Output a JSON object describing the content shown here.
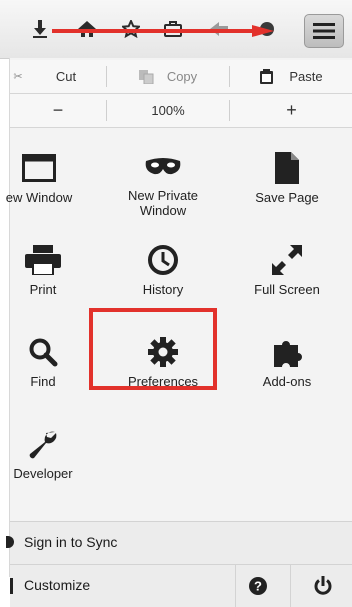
{
  "toolbar": {
    "icons": [
      "download-icon",
      "home-icon",
      "bookmark-star-icon",
      "bag-icon",
      "back-arrow-icon",
      "forward-icon",
      "hamburger-menu-icon"
    ],
    "annotation_arrow_color": "#e2312b"
  },
  "edit": {
    "cut": "Cut",
    "copy": "Copy",
    "paste": "Paste"
  },
  "zoom": {
    "minus": "−",
    "level": "100%",
    "plus": "+"
  },
  "items": [
    {
      "label": "ew Window",
      "icon": "window-icon"
    },
    {
      "label": "New Private Window",
      "icon": "mask-icon"
    },
    {
      "label": "Save Page",
      "icon": "page-icon"
    },
    {
      "label": "Print",
      "icon": "printer-icon"
    },
    {
      "label": "History",
      "icon": "clock-icon"
    },
    {
      "label": "Full Screen",
      "icon": "fullscreen-icon"
    },
    {
      "label": "Find",
      "icon": "magnifier-icon"
    },
    {
      "label": "Preferences",
      "icon": "gear-icon"
    },
    {
      "label": "Add-ons",
      "icon": "puzzle-icon"
    },
    {
      "label": "Developer",
      "icon": "wrench-icon"
    }
  ],
  "footer": {
    "sync": "Sign in to Sync",
    "customize": "Customize"
  },
  "colors": {
    "highlight": "#e2312b",
    "panel_bg": "#f3f3f3"
  }
}
